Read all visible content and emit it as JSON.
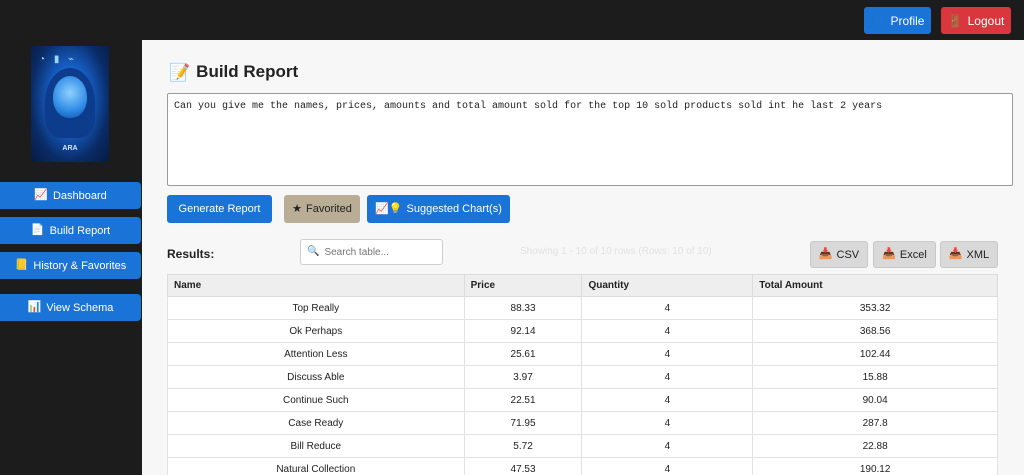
{
  "header": {
    "profile_icon": "👤",
    "profile_label": "Profile",
    "logout_icon": "🚪",
    "logout_label": "Logout"
  },
  "sidebar": {
    "avatar_label": "ARA",
    "items": [
      {
        "icon": "📈",
        "label": "Dashboard"
      },
      {
        "icon": "📄",
        "label": "Build Report"
      },
      {
        "icon": "📒",
        "label": "History & Favorites"
      },
      {
        "icon": "📊",
        "label": "View Schema"
      }
    ]
  },
  "main": {
    "title_icon": "📝",
    "title": "Build Report",
    "query": "Can you give me the names, prices, amounts and total amount sold for the top 10 sold products sold int he last 2 years",
    "buttons": {
      "generate": "Generate Report",
      "favorited_icon": "★",
      "favorited": "Favorited",
      "suggest_icon": "📈💡",
      "suggest": "Suggested Chart(s)"
    },
    "results_label": "Results:",
    "search_placeholder": "Search table...",
    "row_info": "Showing 1 - 10 of 10 rows (Rows: 10 of 10)",
    "export": {
      "icon": "📥",
      "csv": "CSV",
      "excel": "Excel",
      "xml": "XML"
    },
    "table": {
      "headers": [
        "Name",
        "Price",
        "Quantity",
        "Total Amount"
      ],
      "rows": [
        [
          "Top Really",
          "88.33",
          "4",
          "353.32"
        ],
        [
          "Ok Perhaps",
          "92.14",
          "4",
          "368.56"
        ],
        [
          "Attention Less",
          "25.61",
          "4",
          "102.44"
        ],
        [
          "Discuss Able",
          "3.97",
          "4",
          "15.88"
        ],
        [
          "Continue Such",
          "22.51",
          "4",
          "90.04"
        ],
        [
          "Case Ready",
          "71.95",
          "4",
          "287.8"
        ],
        [
          "Bill Reduce",
          "5.72",
          "4",
          "22.88"
        ],
        [
          "Natural Collection",
          "47.53",
          "4",
          "190.12"
        ]
      ]
    }
  },
  "colors": {
    "primary": "#1a73d6",
    "danger": "#d9363e",
    "favorited": "#b9ad95",
    "dark": "#1c1c1c"
  }
}
